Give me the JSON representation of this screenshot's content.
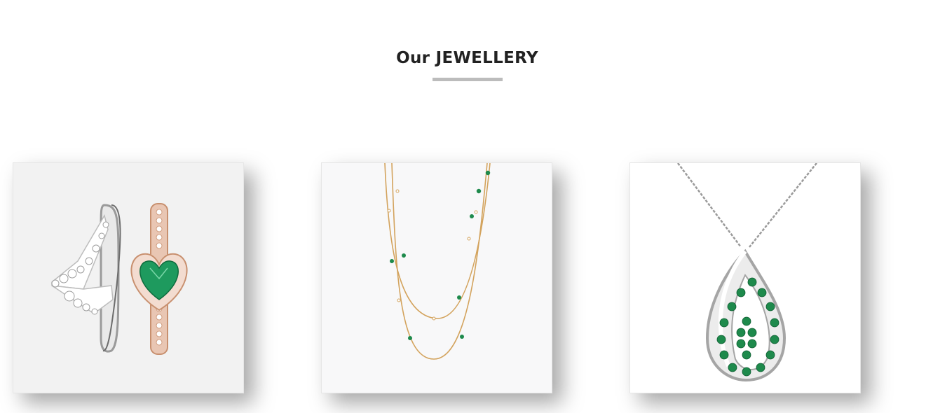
{
  "section": {
    "title": "Our JEWELLERY"
  },
  "products": [
    {
      "name": "rings-product-image",
      "icon": "tiara-and-heart-rings-image"
    },
    {
      "name": "necklace-product-image",
      "icon": "layered-gold-necklace-image"
    },
    {
      "name": "pendant-product-image",
      "icon": "emerald-drop-pendant-image"
    }
  ],
  "colors": {
    "emerald": "#1e8a4c",
    "silver": "#c9c9c9",
    "rose_gold": "#d9a488",
    "gold": "#d3a35d",
    "underline": "#bcbcbc"
  }
}
